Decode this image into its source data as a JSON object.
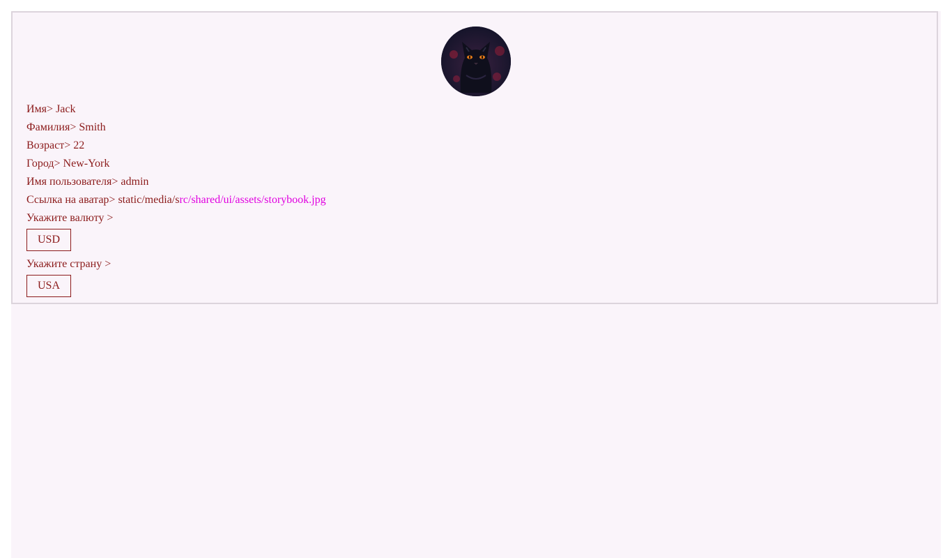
{
  "profile": {
    "first_name": {
      "label": "Имя>",
      "value": "Jack"
    },
    "last_name": {
      "label": "Фамилия>",
      "value": "Smith"
    },
    "age": {
      "label": "Возраст>",
      "value": "22"
    },
    "city": {
      "label": "Город>",
      "value": "New-York"
    },
    "username": {
      "label": "Имя пользователя>",
      "value": "admin"
    },
    "avatar_link": {
      "label": "Ссылка на аватар>",
      "value_prefix": "static/media/s",
      "value_suffix": "rc/shared/ui/assets/storybook.jpg"
    }
  },
  "currency": {
    "label": "Укажите валюту >",
    "selected": "USD"
  },
  "country": {
    "label": "Укажите страну >",
    "selected": "USA"
  },
  "colors": {
    "text": "#8b1a1a",
    "glitch": "#e000e0",
    "background": "#faf4fa",
    "border": "#dcd4dc"
  },
  "avatar_icon": "cat-avatar-icon"
}
